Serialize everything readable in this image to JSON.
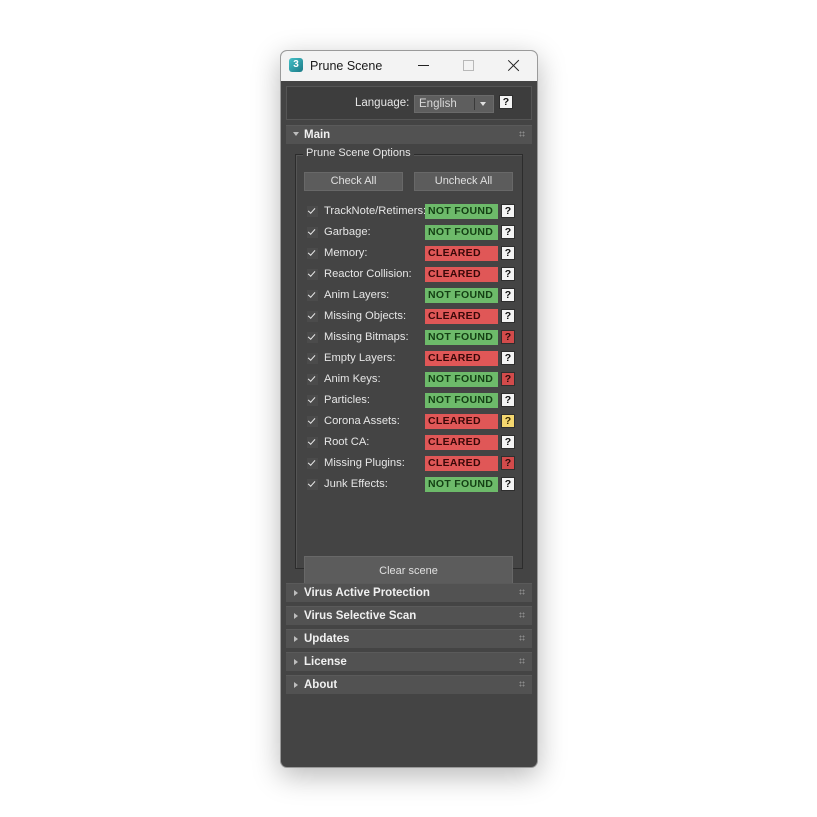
{
  "window": {
    "title": "Prune Scene",
    "app_icon_glyph": "3"
  },
  "language": {
    "label": "Language:",
    "value": "English",
    "help": "?"
  },
  "main": {
    "title": "Main",
    "group_label": "Prune Scene Options",
    "check_all": "Check All",
    "uncheck_all": "Uncheck All",
    "clear_scene": "Clear scene",
    "options": [
      {
        "label": "TrackNote/Retimers:",
        "checked": true,
        "status": "NOT FOUND",
        "state": "notfound",
        "help": "?",
        "help_color": "white"
      },
      {
        "label": "Garbage:",
        "checked": true,
        "status": "NOT FOUND",
        "state": "notfound",
        "help": "?",
        "help_color": "white"
      },
      {
        "label": "Memory:",
        "checked": true,
        "status": "CLEARED",
        "state": "cleared",
        "help": "?",
        "help_color": "white"
      },
      {
        "label": "Reactor Collision:",
        "checked": true,
        "status": "CLEARED",
        "state": "cleared",
        "help": "?",
        "help_color": "white"
      },
      {
        "label": "Anim Layers:",
        "checked": true,
        "status": "NOT FOUND",
        "state": "notfound",
        "help": "?",
        "help_color": "white"
      },
      {
        "label": "Missing Objects:",
        "checked": true,
        "status": "CLEARED",
        "state": "cleared",
        "help": "?",
        "help_color": "white"
      },
      {
        "label": "Missing Bitmaps:",
        "checked": true,
        "status": "NOT FOUND",
        "state": "notfound",
        "help": "?",
        "help_color": "red"
      },
      {
        "label": "Empty Layers:",
        "checked": true,
        "status": "CLEARED",
        "state": "cleared",
        "help": "?",
        "help_color": "white"
      },
      {
        "label": "Anim Keys:",
        "checked": true,
        "status": "NOT FOUND",
        "state": "notfound",
        "help": "?",
        "help_color": "red"
      },
      {
        "label": "Particles:",
        "checked": true,
        "status": "NOT FOUND",
        "state": "notfound",
        "help": "?",
        "help_color": "white"
      },
      {
        "label": "Corona Assets:",
        "checked": true,
        "status": "CLEARED",
        "state": "cleared",
        "help": "?",
        "help_color": "yellow"
      },
      {
        "label": "Root CA:",
        "checked": true,
        "status": "CLEARED",
        "state": "cleared",
        "help": "?",
        "help_color": "white"
      },
      {
        "label": "Missing Plugins:",
        "checked": true,
        "status": "CLEARED",
        "state": "cleared",
        "help": "?",
        "help_color": "red"
      },
      {
        "label": "Junk Effects:",
        "checked": true,
        "status": "NOT FOUND",
        "state": "notfound",
        "help": "?",
        "help_color": "white"
      }
    ]
  },
  "rollouts": [
    {
      "title": "Virus Active Protection"
    },
    {
      "title": "Virus Selective Scan"
    },
    {
      "title": "Updates"
    },
    {
      "title": "License"
    },
    {
      "title": "About"
    }
  ],
  "colors": {
    "not_found_bg": "#6dba6a",
    "cleared_bg": "#e05757",
    "help_red": "#d24b4b",
    "help_yellow": "#f5d870",
    "panel_bg": "#444444"
  },
  "icons": {
    "app": "3dsmax-app-icon",
    "minimize": "minimize-icon",
    "maximize": "maximize-icon",
    "close": "close-icon",
    "dropdown": "chevron-down-icon",
    "check": "check-icon",
    "grip": "grip-icon"
  }
}
